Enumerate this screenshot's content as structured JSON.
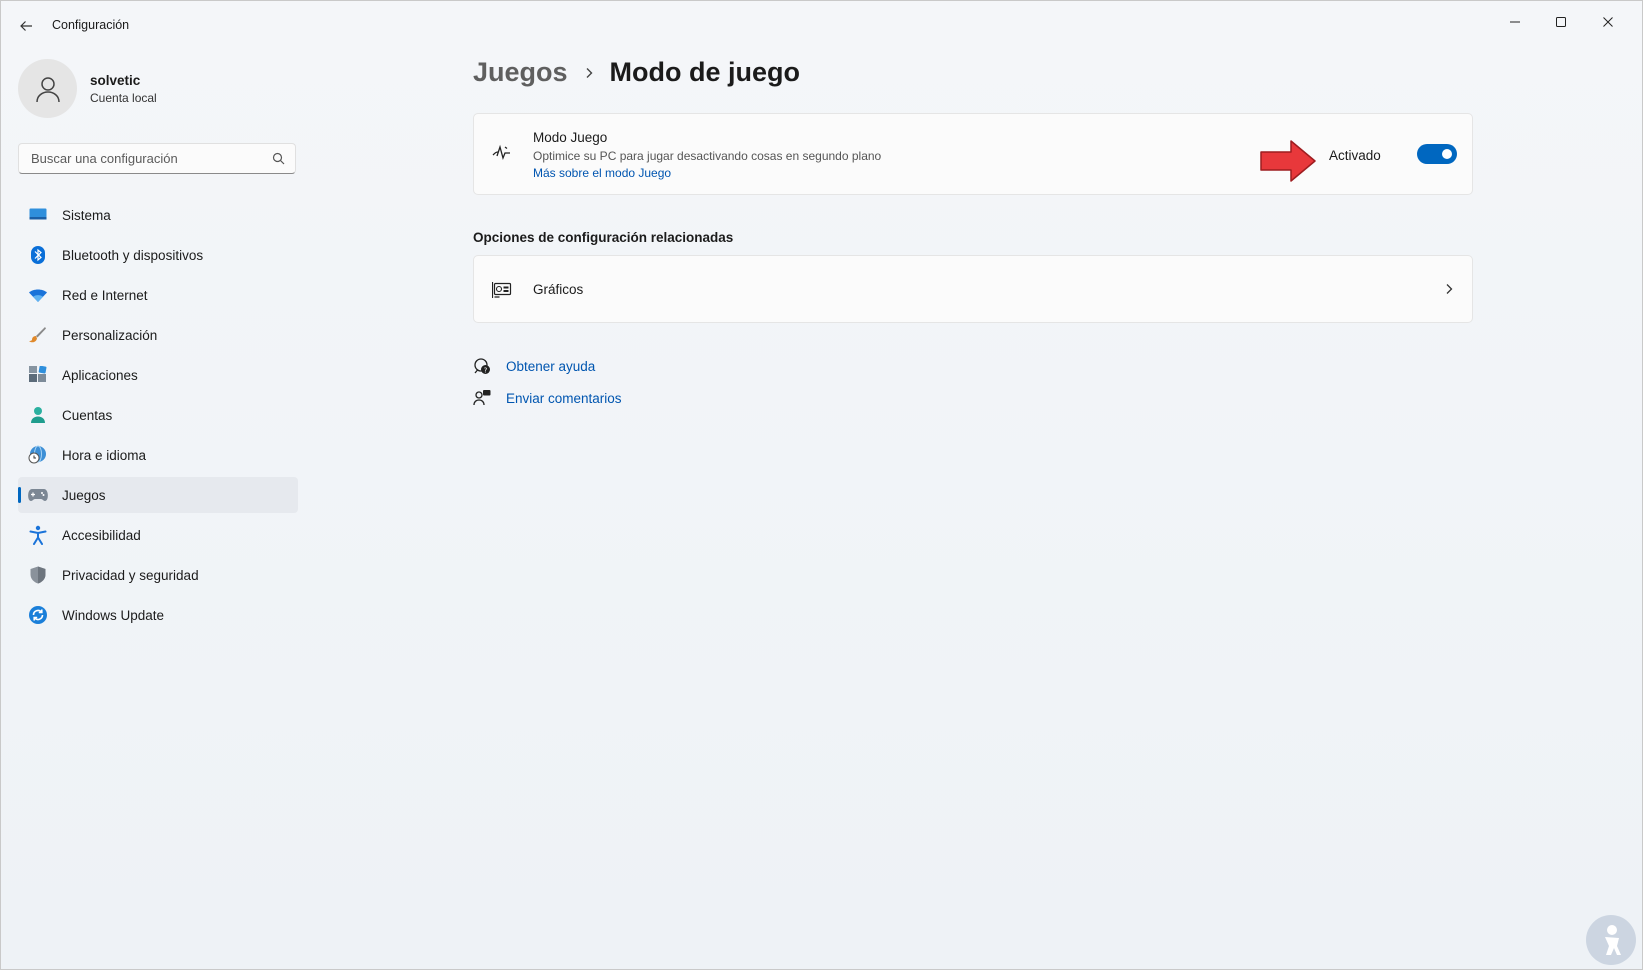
{
  "window": {
    "title": "Configuración",
    "controls": [
      "minimize-icon",
      "maximize-icon",
      "close-icon"
    ]
  },
  "user": {
    "name": "solvetic",
    "account_type": "Cuenta local"
  },
  "search": {
    "placeholder": "Buscar una configuración",
    "value": ""
  },
  "sidebar": {
    "items": [
      {
        "label": "Sistema",
        "icon": "display-icon",
        "active": false
      },
      {
        "label": "Bluetooth y dispositivos",
        "icon": "bluetooth-icon",
        "active": false
      },
      {
        "label": "Red e Internet",
        "icon": "wifi-icon",
        "active": false
      },
      {
        "label": "Personalización",
        "icon": "brush-icon",
        "active": false
      },
      {
        "label": "Aplicaciones",
        "icon": "apps-icon",
        "active": false
      },
      {
        "label": "Cuentas",
        "icon": "person-icon",
        "active": false
      },
      {
        "label": "Hora e idioma",
        "icon": "globe-clock-icon",
        "active": false
      },
      {
        "label": "Juegos",
        "icon": "gamepad-icon",
        "active": true
      },
      {
        "label": "Accesibilidad",
        "icon": "accessibility-icon",
        "active": false
      },
      {
        "label": "Privacidad y seguridad",
        "icon": "shield-icon",
        "active": false
      },
      {
        "label": "Windows Update",
        "icon": "update-icon",
        "active": false
      }
    ]
  },
  "breadcrumb": {
    "parent": "Juegos",
    "current": "Modo de juego"
  },
  "game_mode": {
    "title": "Modo Juego",
    "description": "Optimice su PC para jugar desactivando cosas en segundo plano",
    "link": "Más sobre el modo Juego",
    "state_label": "Activado",
    "enabled": true
  },
  "related": {
    "title": "Opciones de configuración relacionadas",
    "items": [
      {
        "label": "Gráficos",
        "icon": "graphics-card-icon"
      }
    ]
  },
  "help_links": [
    {
      "label": "Obtener ayuda",
      "icon": "help-icon"
    },
    {
      "label": "Enviar comentarios",
      "icon": "feedback-icon"
    }
  ],
  "colors": {
    "accent": "#0067c0",
    "link": "#0055b0",
    "arrow_annotation": "#e8383b"
  }
}
